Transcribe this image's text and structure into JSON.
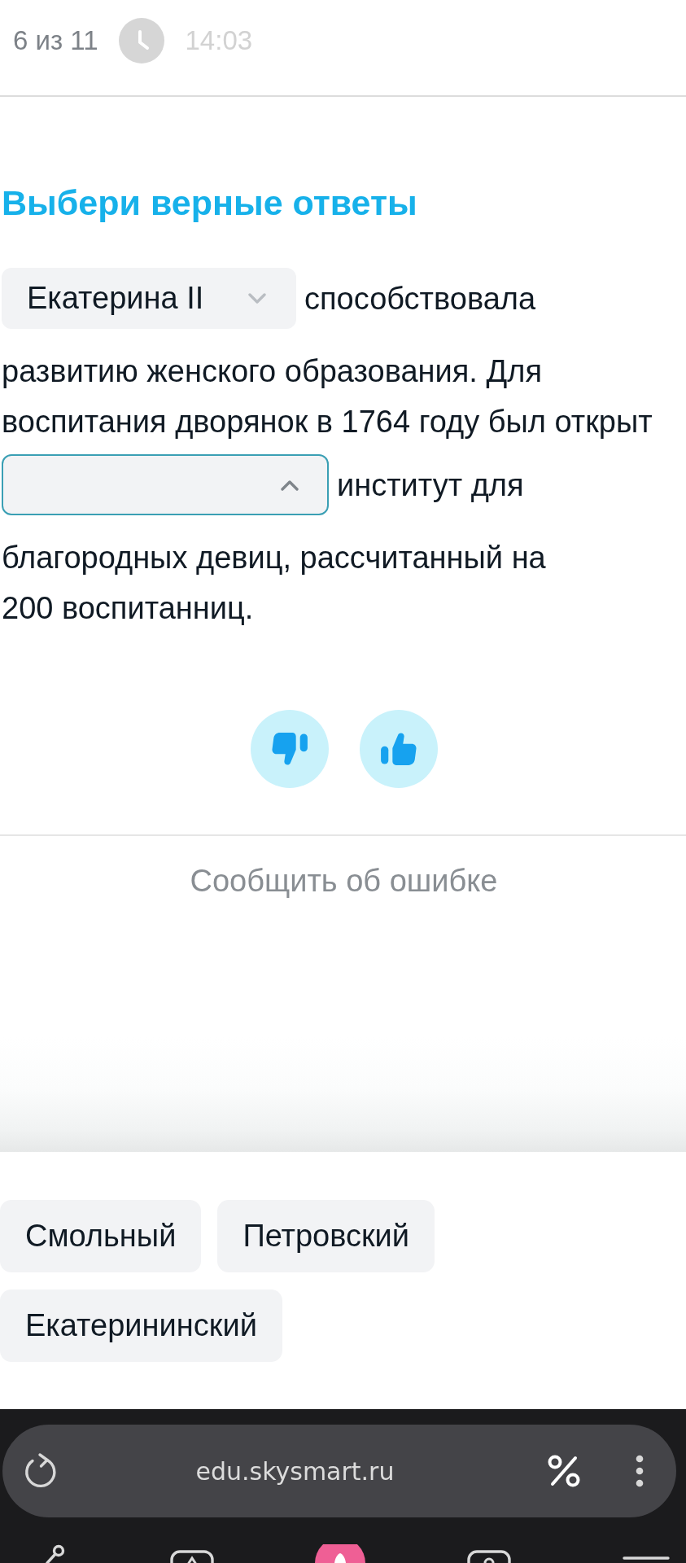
{
  "header": {
    "progress": "6 из 11",
    "timer": "14:03"
  },
  "task": {
    "title": "Выбери верные ответы",
    "lines": [
      [
        {
          "kind": "select",
          "value": "Екатерина II",
          "open": false
        },
        {
          "kind": "text",
          "text": "способствовала"
        }
      ],
      [
        {
          "kind": "text",
          "text": "развитию женского образования. Для"
        }
      ],
      [
        {
          "kind": "text",
          "text": "воспитания дворянок в 1764 году был открыт"
        }
      ],
      [
        {
          "kind": "select",
          "open": true
        },
        {
          "kind": "text",
          "text": "институт для"
        }
      ],
      [
        {
          "kind": "text",
          "text": "благородных девиц, рассчитанный на"
        }
      ],
      [
        {
          "kind": "text",
          "text": "200 воспитанниц."
        }
      ]
    ]
  },
  "report_link": "Сообщить об ошибке",
  "options": [
    {
      "label": "Смольный"
    },
    {
      "label": "Петровский"
    },
    {
      "label": "Екатерининский"
    }
  ],
  "browser": {
    "url": "edu.skysmart.ru"
  }
}
